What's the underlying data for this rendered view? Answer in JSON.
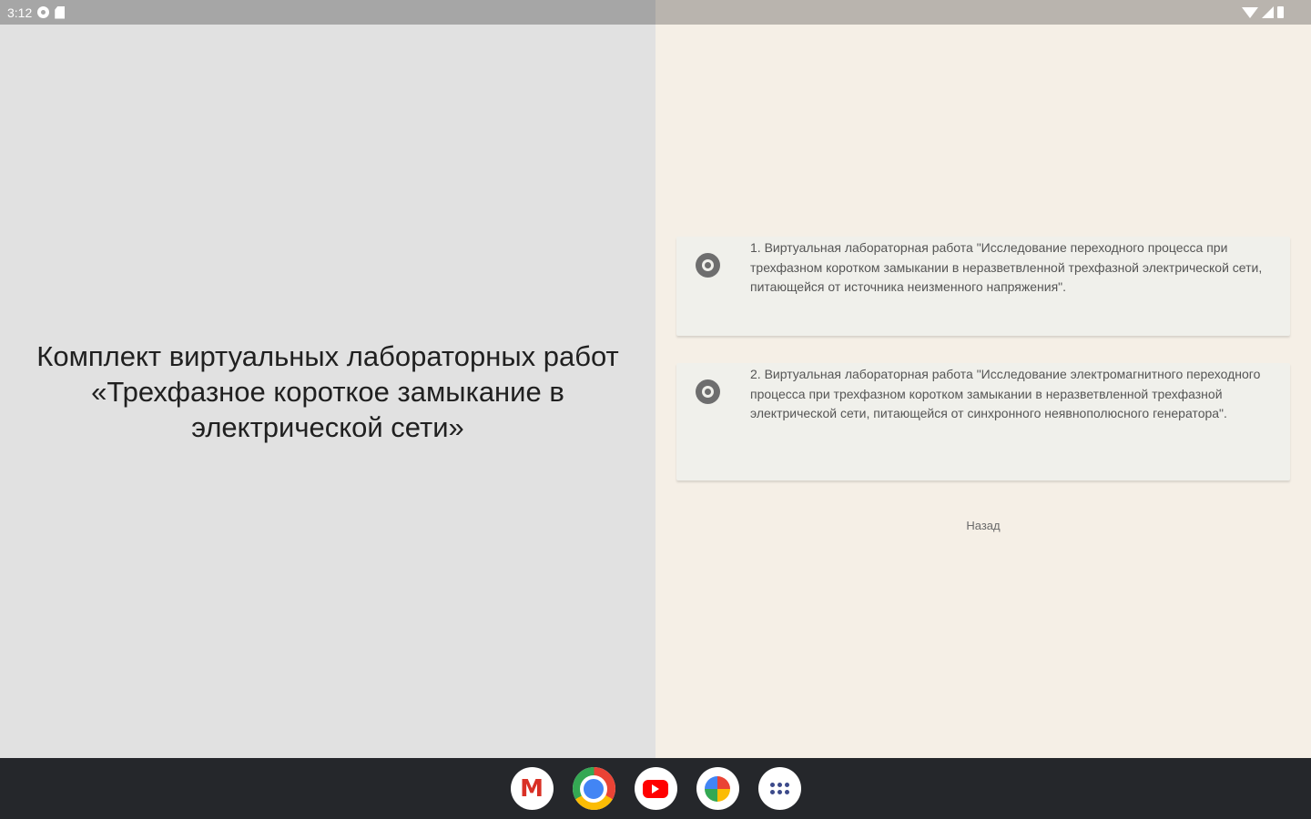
{
  "status_bar": {
    "time": "3:12",
    "left_icons": [
      "circle-status-icon",
      "sd-card-icon"
    ],
    "right_icons": [
      "wifi-icon",
      "signal-icon",
      "battery-icon"
    ]
  },
  "left_pane": {
    "title_line1": "Комплект виртуальных лабораторных работ",
    "title_line2": "«Трехфазное короткое замыкание в",
    "title_line3": "электрической сети»"
  },
  "right_pane": {
    "options": [
      {
        "label": "1. Виртуальная лабораторная работа \"Исследование переходного процесса при трехфазном коротком замыкании в неразветвленной трехфазной электрической сети, питающейся от источника неизменного напряжения\".",
        "selected": false
      },
      {
        "label": "2. Виртуальная лабораторная работа \"Исследование электромагнитного переходного процесса при трехфазном коротком замыкании в неразветвленной трехфазной электрической сети, питающейся от синхронного неявнополюсного генератора\".",
        "selected": false
      }
    ],
    "back_label": "Назад"
  },
  "taskbar": {
    "apps": [
      "gmail-icon",
      "chrome-icon",
      "youtube-icon",
      "photos-icon",
      "app-launcher-icon"
    ]
  },
  "colors": {
    "left_background": "#e1e1e1",
    "right_background": "#f5efe6",
    "card_background": "#f0f0eb",
    "taskbar_background": "#25272b",
    "status_left": "#a6a6a6",
    "status_right": "#b9b4ae"
  }
}
